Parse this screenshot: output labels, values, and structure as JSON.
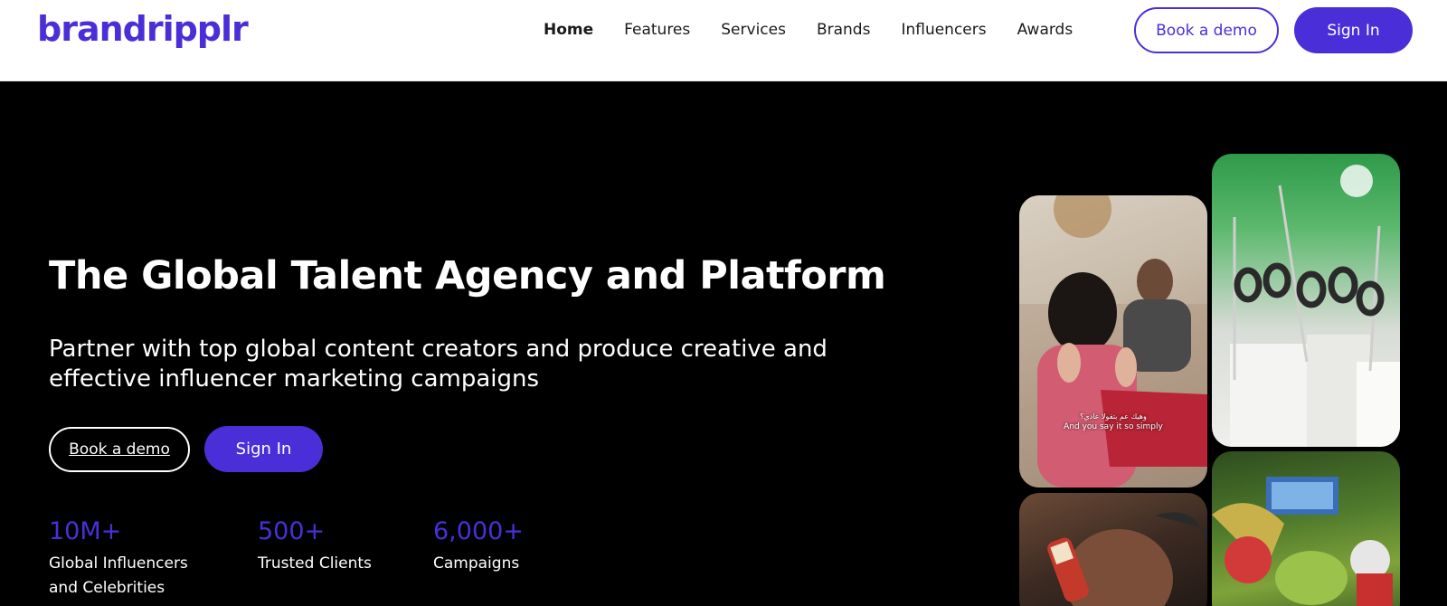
{
  "header": {
    "logo": "brandripplr",
    "nav": [
      "Home",
      "Features",
      "Services",
      "Brands",
      "Influencers",
      "Awards"
    ],
    "book_demo": "Book a demo",
    "sign_in": "Sign In"
  },
  "hero": {
    "title": "The Global Talent Agency and Platform",
    "subtitle": "Partner with top global content creators and produce creative and effective influencer marketing campaigns",
    "book_demo": "Book a demo",
    "sign_in": "Sign In"
  },
  "stats": [
    {
      "value": "10M+",
      "label_line1": "Global Influencers",
      "label_line2": "and Celebrities"
    },
    {
      "value": "500+",
      "label_line1": "Trusted Clients",
      "label_line2": ""
    },
    {
      "value": "6,000+",
      "label_line1": "Campaigns",
      "label_line2": ""
    }
  ],
  "collage": {
    "couple_caption_arabic": "وهيك عم بتقولا عادي؟",
    "couple_caption_english": "And you say it so simply"
  },
  "colors": {
    "brand": "#4a2fd9",
    "background": "#000000",
    "header_bg": "#ffffff"
  }
}
